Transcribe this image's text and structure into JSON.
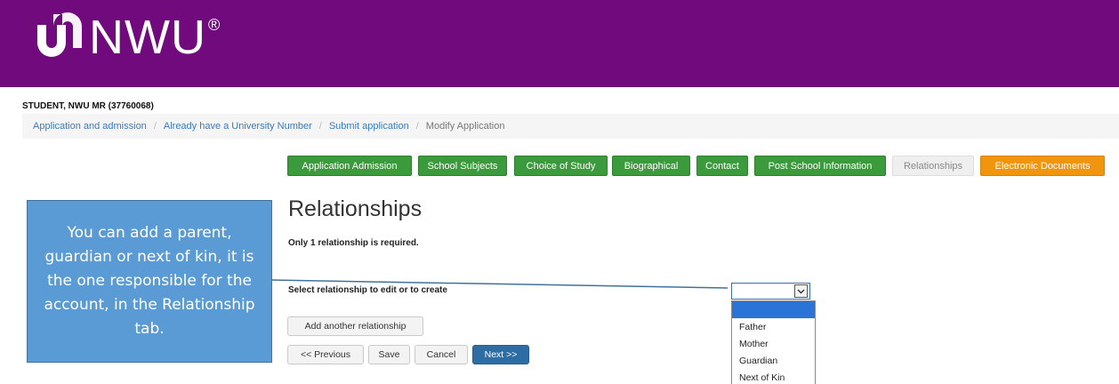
{
  "brand": {
    "name": "NWU",
    "registered": "®",
    "header_color": "#710a7c"
  },
  "student_label": "STUDENT, NWU MR (37760068)",
  "breadcrumb": [
    "Application and admission",
    "Already have a University Number",
    "Submit application",
    "Modify Application"
  ],
  "tabs": [
    {
      "label": "Application Admission",
      "state": "complete"
    },
    {
      "label": "School Subjects",
      "state": "complete"
    },
    {
      "label": "Choice of Study",
      "state": "complete"
    },
    {
      "label": "Biographical",
      "state": "complete"
    },
    {
      "label": "Contact",
      "state": "complete"
    },
    {
      "label": "Post School Information",
      "state": "complete"
    },
    {
      "label": "Relationships",
      "state": "active"
    },
    {
      "label": "Electronic Documents",
      "state": "pending"
    }
  ],
  "page": {
    "title": "Relationships",
    "note": "Only 1 relationship is required.",
    "select_label": "Select relationship to edit or to create",
    "select_value": ""
  },
  "dropdown": {
    "options": [
      "",
      "Father",
      "Mother",
      "Guardian",
      "Next of Kin"
    ],
    "selected_index": 0
  },
  "buttons": {
    "add_relationship": "Add another relationship",
    "previous": "<< Previous",
    "save": "Save",
    "cancel": "Cancel",
    "next": "Next >>"
  },
  "callout": {
    "text": "You can add a parent, guardian or next of kin, it is the one responsible for the account, in the Relationship tab."
  },
  "colors": {
    "tab_complete": "#3b9a3b",
    "tab_active": "#efefef",
    "tab_pending": "#f0950d",
    "primary_button": "#2e6da4",
    "callout": "#5b9bd5"
  }
}
